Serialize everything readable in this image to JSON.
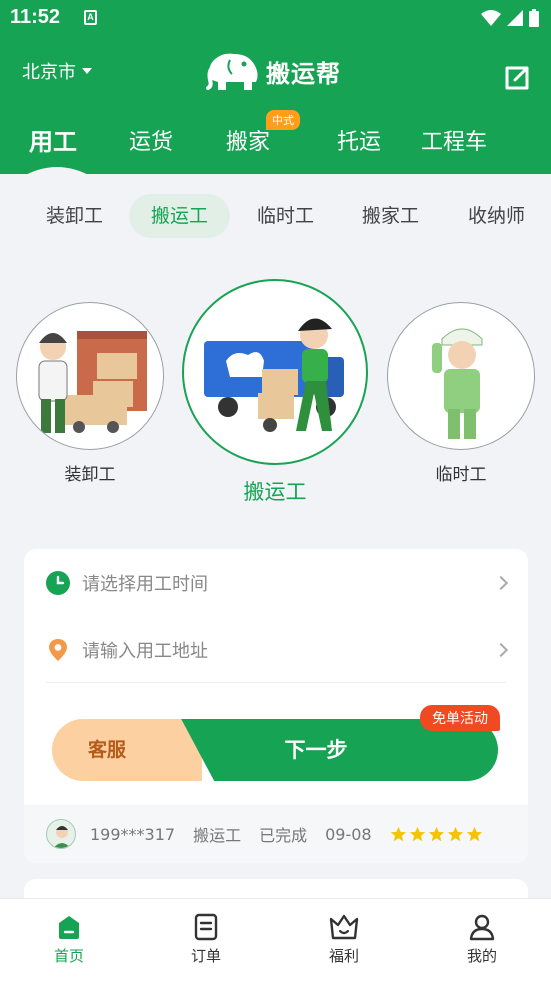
{
  "status_bar": {
    "time": "11:52"
  },
  "header": {
    "city": "北京市",
    "logo_text": "搬运帮",
    "service_tabs": [
      {
        "label": "用工",
        "active": true
      },
      {
        "label": "运货"
      },
      {
        "label": "搬家",
        "badge": "中式"
      },
      {
        "label": "托运"
      },
      {
        "label": "工程车"
      }
    ]
  },
  "job_tabs": [
    {
      "label": "装卸工"
    },
    {
      "label": "搬运工",
      "active": true
    },
    {
      "label": "临时工"
    },
    {
      "label": "搬家工"
    },
    {
      "label": "收纳师"
    }
  ],
  "workers": [
    {
      "label": "装卸工"
    },
    {
      "label": "搬运工",
      "selected": true
    },
    {
      "label": "临时工"
    }
  ],
  "form": {
    "time_placeholder": "请选择用工时间",
    "address_placeholder": "请输入用工地址",
    "customer_service": "客服",
    "next": "下一步",
    "promo": "免单活动"
  },
  "ticker": {
    "phone": "199***317",
    "job": "搬运工",
    "status": "已完成",
    "date": "09-08",
    "stars": 5
  },
  "bottom_nav": [
    {
      "label": "首页",
      "icon": "home-icon",
      "active": true
    },
    {
      "label": "订单",
      "icon": "order-icon"
    },
    {
      "label": "福利",
      "icon": "crown-icon"
    },
    {
      "label": "我的",
      "icon": "user-icon"
    }
  ],
  "colors": {
    "primary": "#16a353",
    "accent_orange": "#f04a22",
    "cs_peach": "#fdd0a2",
    "star": "#f5c400"
  }
}
